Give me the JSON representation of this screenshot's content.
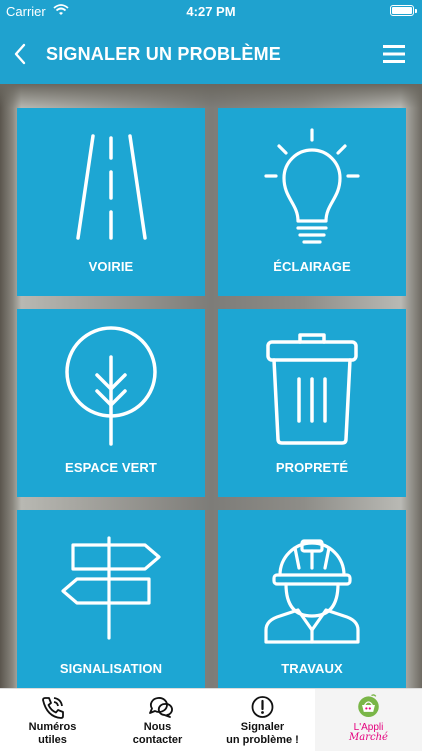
{
  "status_bar": {
    "carrier": "Carrier",
    "time": "4:27 PM"
  },
  "header": {
    "title": "SIGNALER UN PROBLÈME",
    "back_icon": "chevron-left-icon",
    "menu_icon": "hamburger-menu-icon"
  },
  "tiles": [
    {
      "label": "VOIRIE",
      "icon": "road-icon"
    },
    {
      "label": "ÉCLAIRAGE",
      "icon": "light-bulb-icon"
    },
    {
      "label": "ESPACE VERT",
      "icon": "tree-icon"
    },
    {
      "label": "PROPRETÉ",
      "icon": "trash-can-icon"
    },
    {
      "label": "SIGNALISATION",
      "icon": "signpost-icon"
    },
    {
      "label": "TRAVAUX",
      "icon": "construction-worker-icon"
    }
  ],
  "tabbar": {
    "tabs": [
      {
        "label_line1": "Numéros",
        "label_line2": "utiles",
        "icon": "phone-icon"
      },
      {
        "label_line1": "Nous",
        "label_line2": "contacter",
        "icon": "chat-bubbles-icon"
      },
      {
        "label_line1": "Signaler",
        "label_line2": "un problème !",
        "icon": "exclamation-circle-icon"
      },
      {
        "logo_line1": "L'Appli",
        "logo_line2": "Marché",
        "icon": "appli-marche-logo"
      }
    ]
  },
  "colors": {
    "primary": "#1fa2cf",
    "tile": "#1da6d3",
    "logo_pink": "#e4007d",
    "logo_green": "#7ab648"
  }
}
